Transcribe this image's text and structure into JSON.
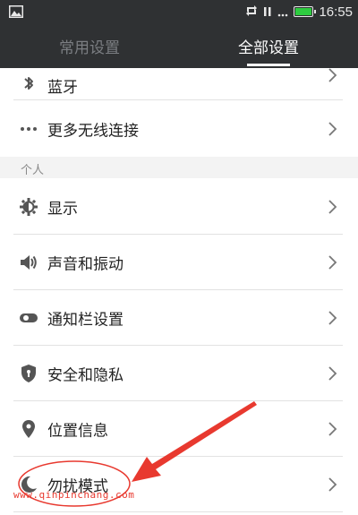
{
  "status_bar": {
    "time": "16:55",
    "icons": [
      "image-icon",
      "sync-icon",
      "pause-icon",
      "battery-icon"
    ],
    "battery_color": "#2ecc40"
  },
  "tabs": [
    {
      "label": "常用设置",
      "active": false
    },
    {
      "label": "全部设置",
      "active": true
    }
  ],
  "rows_top": [
    {
      "icon": "bluetooth-icon",
      "label": "蓝牙"
    },
    {
      "icon": "more-dots-icon",
      "label": "更多无线连接"
    }
  ],
  "section_personal": "个人",
  "rows_personal": [
    {
      "icon": "display-gear-icon",
      "label": "显示"
    },
    {
      "icon": "speaker-icon",
      "label": "声音和振动"
    },
    {
      "icon": "toggle-icon",
      "label": "通知栏设置"
    },
    {
      "icon": "shield-icon",
      "label": "安全和隐私"
    },
    {
      "icon": "location-pin-icon",
      "label": "位置信息"
    },
    {
      "icon": "moon-icon",
      "label": "勿扰模式"
    }
  ],
  "watermark": "www.qinpinchang.com",
  "colors": {
    "header_bg": "#2f3133",
    "annotation_red": "#e8392f"
  }
}
